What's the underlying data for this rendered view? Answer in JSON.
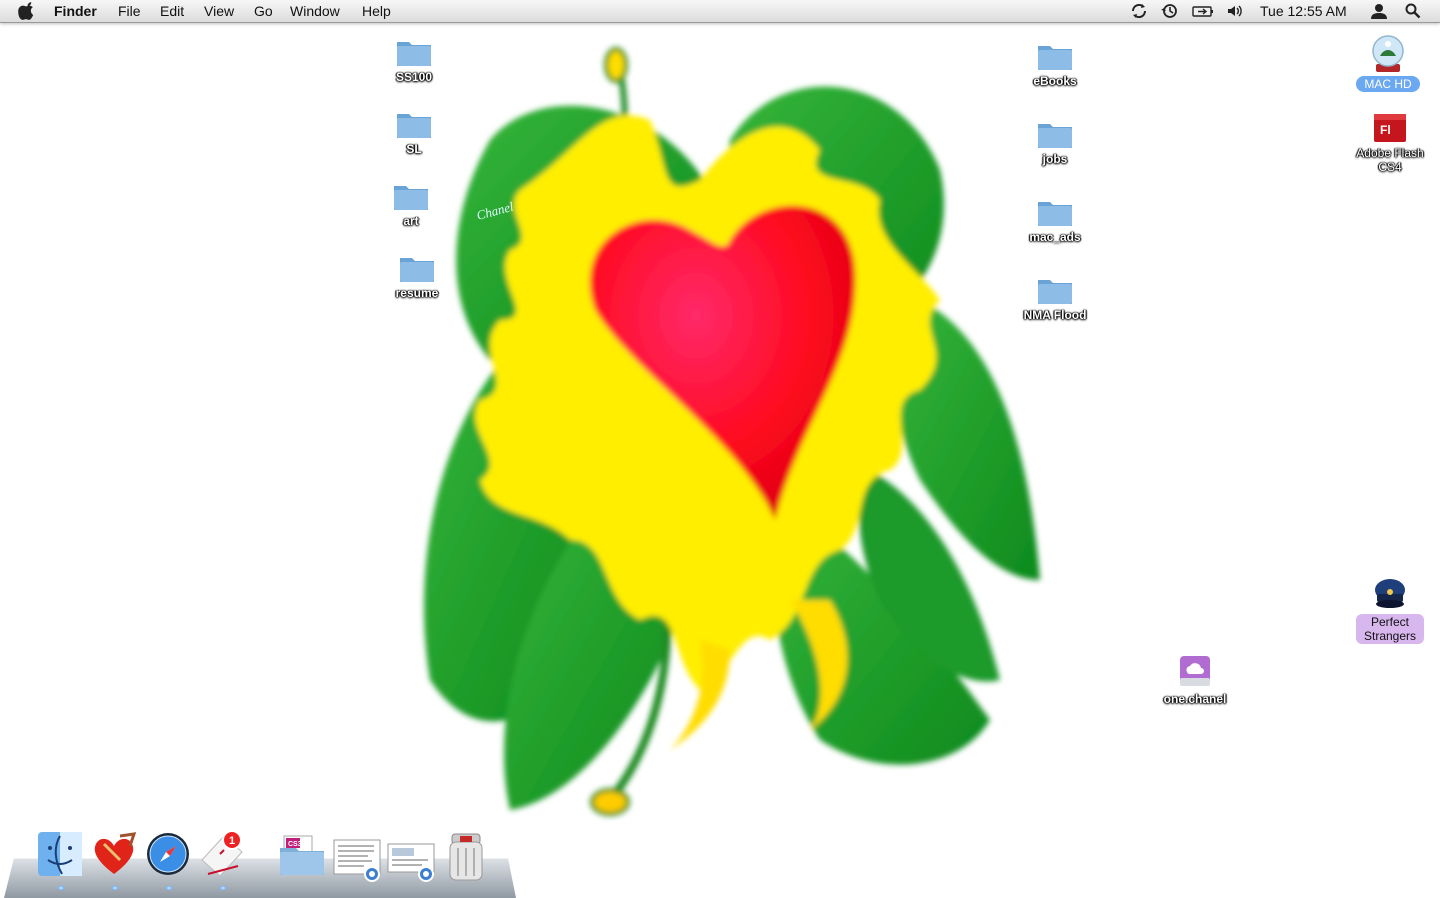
{
  "menubar": {
    "app_name": "Finder",
    "menus": [
      "File",
      "Edit",
      "View",
      "Go",
      "Window",
      "Help"
    ],
    "clock": "Tue 12:55 AM",
    "status_icons": [
      "sync-icon",
      "time-machine-icon",
      "battery-icon",
      "volume-icon",
      "user-icon",
      "spotlight-icon"
    ]
  },
  "desktop": {
    "icons_left": [
      {
        "label": "SS100",
        "icon": "folder-icon"
      },
      {
        "label": "SL",
        "icon": "folder-icon"
      },
      {
        "label": "art",
        "icon": "folder-icon"
      },
      {
        "label": "resume",
        "icon": "folder-icon"
      }
    ],
    "icons_right": [
      {
        "label": "eBooks",
        "icon": "folder-icon"
      },
      {
        "label": "jobs",
        "icon": "folder-icon"
      },
      {
        "label": "mac_ads",
        "icon": "folder-icon"
      },
      {
        "label": "NMA Flood",
        "icon": "folder-icon"
      }
    ],
    "mac_hd": {
      "label": "MAC HD",
      "icon": "hard-drive-icon"
    },
    "flash": {
      "label_line1": "Adobe Flash",
      "label_line2": "CS4",
      "icon": "flash-app-icon",
      "glyph": "Fl"
    },
    "perfect_strangers": {
      "label_line1": "Perfect",
      "label_line2": "Strangers",
      "icon": "pilot-hat-icon"
    },
    "one_chanel": {
      "label": "one.chanel",
      "icon": "cloud-drive-icon"
    }
  },
  "dock": {
    "items": [
      {
        "name": "finder-icon",
        "running": true
      },
      {
        "name": "heart-app-icon",
        "running": true
      },
      {
        "name": "safari-icon",
        "running": true
      },
      {
        "name": "mail-icon",
        "running": true,
        "badge": "1"
      },
      {
        "name": "applications-folder-icon",
        "running": false,
        "glyph": "CS3"
      },
      {
        "name": "documents-stack-icon",
        "running": false
      },
      {
        "name": "downloads-stack-icon",
        "running": false
      },
      {
        "name": "trash-icon",
        "running": false
      }
    ]
  },
  "colors": {
    "menubar_top": "#f7f7f7",
    "menubar_bottom": "#dcdcdc",
    "folder_blue": "#7fb3e0",
    "leaf_green": "#2aa02a",
    "flame_yellow": "#ffee00",
    "heart_red": "#ff1030",
    "selection_blue": "#6aa8f2",
    "selection_purple": "#d8b6ee"
  }
}
